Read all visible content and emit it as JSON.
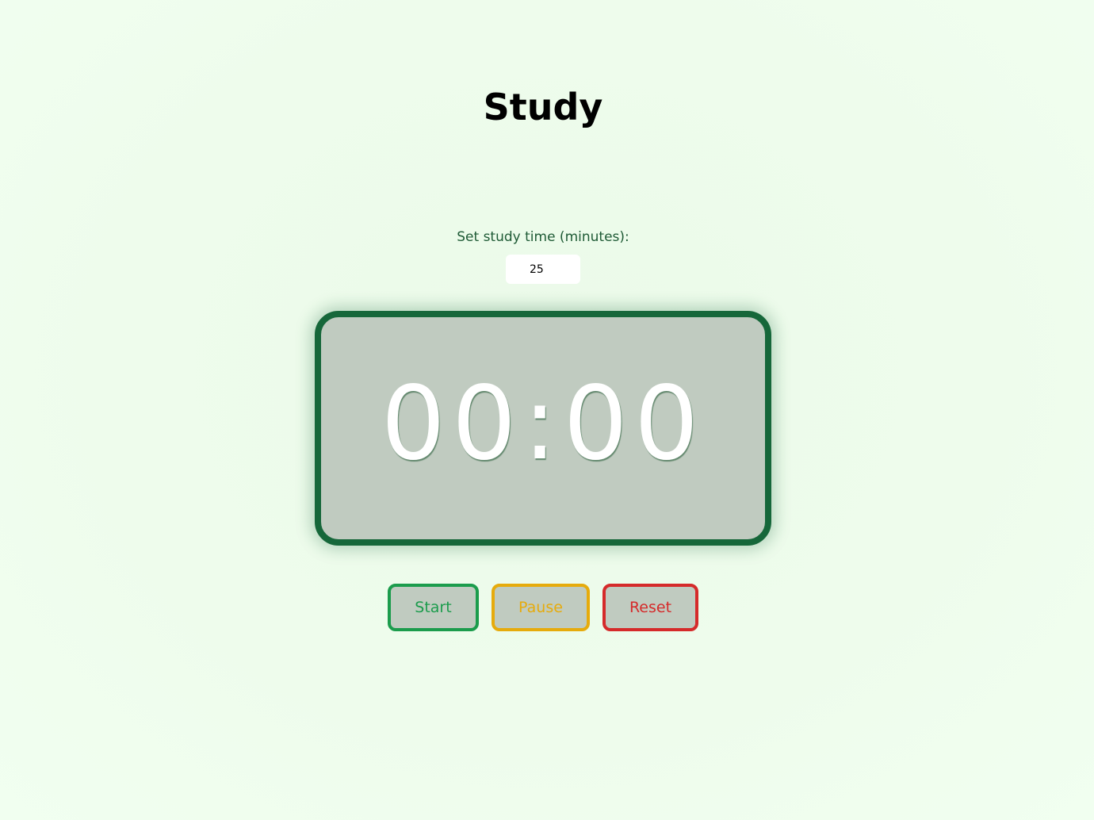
{
  "page": {
    "title": "Study"
  },
  "settings": {
    "label": "Set study time (minutes):",
    "minutes_value": "25"
  },
  "timer": {
    "display": "00:00"
  },
  "controls": {
    "start_label": "Start",
    "pause_label": "Pause",
    "reset_label": "Reset"
  },
  "colors": {
    "background": "#eefcec",
    "timer_border": "#16673a",
    "timer_face": "#c0cbc0",
    "start": "#1b9c4c",
    "pause": "#e6ab0c",
    "reset": "#d52a2a",
    "label_text": "#1e5a35"
  }
}
